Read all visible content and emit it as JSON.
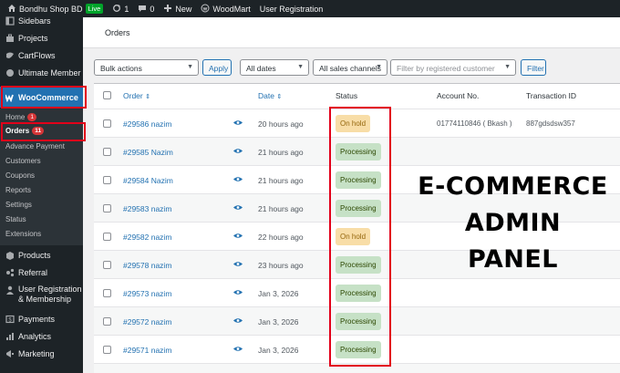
{
  "admin_bar": {
    "site_name": "Bondhu Shop BD",
    "live_badge": "Live",
    "updates_count": "1",
    "comments_count": "0",
    "new_label": "New",
    "woodmart_label": "WoodMart",
    "user_registration_label": "User Registration"
  },
  "sidebar": {
    "items_top": [
      {
        "label": "Sidebars",
        "icon": "sidebar-icon"
      },
      {
        "label": "Projects",
        "icon": "briefcase-icon"
      },
      {
        "label": "CartFlows",
        "icon": "flow-icon"
      },
      {
        "label": "Ultimate Member",
        "icon": "users-icon"
      }
    ],
    "woocommerce_label": "WooCommerce",
    "woocommerce_sub": [
      {
        "label": "Home",
        "badge": "1"
      },
      {
        "label": "Orders",
        "badge": "11"
      },
      {
        "label": "Advance Payment"
      },
      {
        "label": "Customers"
      },
      {
        "label": "Coupons"
      },
      {
        "label": "Reports"
      },
      {
        "label": "Settings"
      },
      {
        "label": "Status"
      },
      {
        "label": "Extensions"
      }
    ],
    "items_bottom": [
      {
        "label": "Products",
        "icon": "box-icon"
      },
      {
        "label": "Referral",
        "icon": "referral-icon"
      },
      {
        "label": "User Registration",
        "label2": "& Membership",
        "icon": "user-reg-icon"
      },
      {
        "label": "Payments",
        "icon": "payments-icon"
      },
      {
        "label": "Analytics",
        "icon": "analytics-icon"
      },
      {
        "label": "Marketing",
        "icon": "megaphone-icon"
      }
    ]
  },
  "page": {
    "title": "Orders"
  },
  "filters": {
    "bulk_actions": "Bulk actions",
    "apply_label": "Apply",
    "dates": "All dates",
    "sales_channels": "All sales channels",
    "customer_placeholder": "Filter by registered customer",
    "filter_label": "Filter"
  },
  "table": {
    "headers": {
      "order": "Order",
      "date": "Date",
      "status": "Status",
      "account": "Account No.",
      "transaction": "Transaction ID"
    },
    "rows": [
      {
        "order": "#29586 nazim",
        "date": "20 hours ago",
        "status": "On hold",
        "account": "01774110846 ( Bkash )",
        "transaction": "887gdsdsw357"
      },
      {
        "order": "#29585 Nazim",
        "date": "21 hours ago",
        "status": "Processing",
        "account": "",
        "transaction": ""
      },
      {
        "order": "#29584 Nazim",
        "date": "21 hours ago",
        "status": "Processing",
        "account": "",
        "transaction": ""
      },
      {
        "order": "#29583 nazim",
        "date": "21 hours ago",
        "status": "Processing",
        "account": "",
        "transaction": ""
      },
      {
        "order": "#29582 nazim",
        "date": "22 hours ago",
        "status": "On hold",
        "account": "",
        "transaction": ""
      },
      {
        "order": "#29578 nazim",
        "date": "23 hours ago",
        "status": "Processing",
        "account": "",
        "transaction": ""
      },
      {
        "order": "#29573 nazim",
        "date": "Jan 3, 2026",
        "status": "Processing",
        "account": "",
        "transaction": ""
      },
      {
        "order": "#29572 nazim",
        "date": "Jan 3, 2026",
        "status": "Processing",
        "account": "",
        "transaction": ""
      },
      {
        "order": "#29571 nazim",
        "date": "Jan 3, 2026",
        "status": "Processing",
        "account": "",
        "transaction": ""
      }
    ]
  },
  "overlay": {
    "line1": "E-COMMERCE",
    "line2": "ADMIN",
    "line3": "PANEL"
  },
  "colors": {
    "accent": "#2271b1",
    "highlight": "#e2001a",
    "processing_bg": "#c6e1c6",
    "onhold_bg": "#f8dda7"
  }
}
